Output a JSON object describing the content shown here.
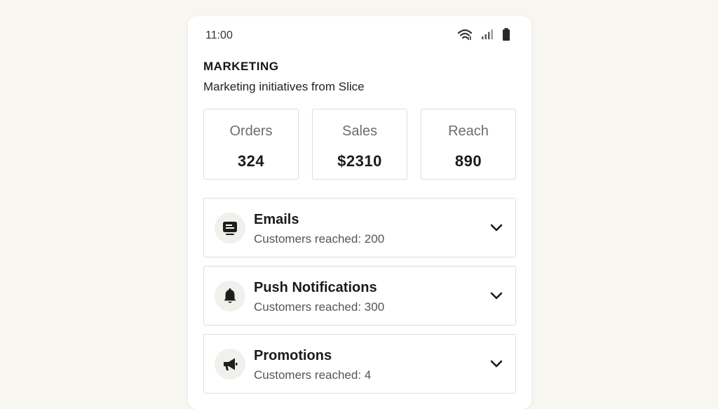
{
  "status_bar": {
    "time": "11:00",
    "icons": [
      "wifi-icon",
      "signal-icon",
      "battery-icon"
    ]
  },
  "header": {
    "title": "MARKETING",
    "subtitle": "Marketing initiatives from Slice"
  },
  "stats": [
    {
      "label": "Orders",
      "value": "324"
    },
    {
      "label": "Sales",
      "value": "$2310"
    },
    {
      "label": "Reach",
      "value": "890"
    }
  ],
  "campaigns": [
    {
      "title": "Emails",
      "subtitle": "Customers reached: 200",
      "icon": "newsletter-icon"
    },
    {
      "title": "Push Notifications",
      "subtitle": "Customers reached: 300",
      "icon": "bell-icon"
    },
    {
      "title": "Promotions",
      "subtitle": "Customers reached: 4",
      "icon": "megaphone-icon"
    }
  ],
  "colors": {
    "background": "#f8f6f1",
    "card_border": "#dedede",
    "icon_circle": "#f2f0ec",
    "text_primary": "#1b1b1b",
    "text_muted": "#6d6d6d"
  }
}
